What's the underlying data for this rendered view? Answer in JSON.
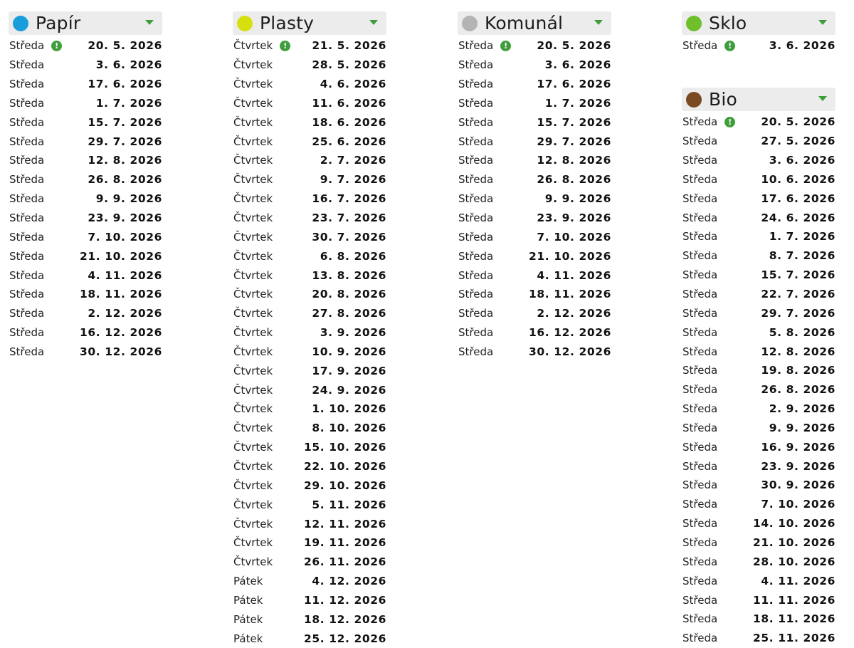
{
  "columns": [
    {
      "title": "Papír",
      "color": "#1a9ddb",
      "rows": [
        {
          "day": "Středa",
          "date": "20. 5. 2026",
          "alert": true
        },
        {
          "day": "Středa",
          "date": "3. 6. 2026"
        },
        {
          "day": "Středa",
          "date": "17. 6. 2026"
        },
        {
          "day": "Středa",
          "date": "1. 7. 2026"
        },
        {
          "day": "Středa",
          "date": "15. 7. 2026"
        },
        {
          "day": "Středa",
          "date": "29. 7. 2026"
        },
        {
          "day": "Středa",
          "date": "12. 8. 2026"
        },
        {
          "day": "Středa",
          "date": "26. 8. 2026"
        },
        {
          "day": "Středa",
          "date": "9. 9. 2026"
        },
        {
          "day": "Středa",
          "date": "23. 9. 2026"
        },
        {
          "day": "Středa",
          "date": "7. 10. 2026"
        },
        {
          "day": "Středa",
          "date": "21. 10. 2026"
        },
        {
          "day": "Středa",
          "date": "4. 11. 2026"
        },
        {
          "day": "Středa",
          "date": "18. 11. 2026"
        },
        {
          "day": "Středa",
          "date": "2. 12. 2026"
        },
        {
          "day": "Středa",
          "date": "16. 12. 2026"
        },
        {
          "day": "Středa",
          "date": "30. 12. 2026"
        }
      ]
    },
    {
      "title": "Plasty",
      "color": "#d6e00e",
      "rows": [
        {
          "day": "Čtvrtek",
          "date": "21. 5. 2026",
          "alert": true
        },
        {
          "day": "Čtvrtek",
          "date": "28. 5. 2026"
        },
        {
          "day": "Čtvrtek",
          "date": "4. 6. 2026"
        },
        {
          "day": "Čtvrtek",
          "date": "11. 6. 2026"
        },
        {
          "day": "Čtvrtek",
          "date": "18. 6. 2026"
        },
        {
          "day": "Čtvrtek",
          "date": "25. 6. 2026"
        },
        {
          "day": "Čtvrtek",
          "date": "2. 7. 2026"
        },
        {
          "day": "Čtvrtek",
          "date": "9. 7. 2026"
        },
        {
          "day": "Čtvrtek",
          "date": "16. 7. 2026"
        },
        {
          "day": "Čtvrtek",
          "date": "23. 7. 2026"
        },
        {
          "day": "Čtvrtek",
          "date": "30. 7. 2026"
        },
        {
          "day": "Čtvrtek",
          "date": "6. 8. 2026"
        },
        {
          "day": "Čtvrtek",
          "date": "13. 8. 2026"
        },
        {
          "day": "Čtvrtek",
          "date": "20. 8. 2026"
        },
        {
          "day": "Čtvrtek",
          "date": "27. 8. 2026"
        },
        {
          "day": "Čtvrtek",
          "date": "3. 9. 2026"
        },
        {
          "day": "Čtvrtek",
          "date": "10. 9. 2026"
        },
        {
          "day": "Čtvrtek",
          "date": "17. 9. 2026"
        },
        {
          "day": "Čtvrtek",
          "date": "24. 9. 2026"
        },
        {
          "day": "Čtvrtek",
          "date": "1. 10. 2026"
        },
        {
          "day": "Čtvrtek",
          "date": "8. 10. 2026"
        },
        {
          "day": "Čtvrtek",
          "date": "15. 10. 2026"
        },
        {
          "day": "Čtvrtek",
          "date": "22. 10. 2026"
        },
        {
          "day": "Čtvrtek",
          "date": "29. 10. 2026"
        },
        {
          "day": "Čtvrtek",
          "date": "5. 11. 2026"
        },
        {
          "day": "Čtvrtek",
          "date": "12. 11. 2026"
        },
        {
          "day": "Čtvrtek",
          "date": "19. 11. 2026"
        },
        {
          "day": "Čtvrtek",
          "date": "26. 11. 2026"
        },
        {
          "day": "Pátek",
          "date": "4. 12. 2026"
        },
        {
          "day": "Pátek",
          "date": "11. 12. 2026"
        },
        {
          "day": "Pátek",
          "date": "18. 12. 2026"
        },
        {
          "day": "Pátek",
          "date": "25. 12. 2026"
        }
      ]
    },
    {
      "title": "Komunál",
      "color": "#b4b4b4",
      "rows": [
        {
          "day": "Středa",
          "date": "20. 5. 2026",
          "alert": true
        },
        {
          "day": "Středa",
          "date": "3. 6. 2026"
        },
        {
          "day": "Středa",
          "date": "17. 6. 2026"
        },
        {
          "day": "Středa",
          "date": "1. 7. 2026"
        },
        {
          "day": "Středa",
          "date": "15. 7. 2026"
        },
        {
          "day": "Středa",
          "date": "29. 7. 2026"
        },
        {
          "day": "Středa",
          "date": "12. 8. 2026"
        },
        {
          "day": "Středa",
          "date": "26. 8. 2026"
        },
        {
          "day": "Středa",
          "date": "9. 9. 2026"
        },
        {
          "day": "Středa",
          "date": "23. 9. 2026"
        },
        {
          "day": "Středa",
          "date": "7. 10. 2026"
        },
        {
          "day": "Středa",
          "date": "21. 10. 2026"
        },
        {
          "day": "Středa",
          "date": "4. 11. 2026"
        },
        {
          "day": "Středa",
          "date": "18. 11. 2026"
        },
        {
          "day": "Středa",
          "date": "2. 12. 2026"
        },
        {
          "day": "Středa",
          "date": "16. 12. 2026"
        },
        {
          "day": "Středa",
          "date": "30. 12. 2026"
        }
      ]
    },
    {
      "title": "Sklo",
      "color": "#6fbf2a",
      "rows": [
        {
          "day": "Středa",
          "date": "3. 6. 2026",
          "alert": true
        }
      ]
    },
    {
      "title": "Bio",
      "color": "#7a4a21",
      "rows": [
        {
          "day": "Středa",
          "date": "20. 5. 2026",
          "alert": true
        },
        {
          "day": "Středa",
          "date": "27. 5. 2026"
        },
        {
          "day": "Středa",
          "date": "3. 6. 2026"
        },
        {
          "day": "Středa",
          "date": "10. 6. 2026"
        },
        {
          "day": "Středa",
          "date": "17. 6. 2026"
        },
        {
          "day": "Středa",
          "date": "24. 6. 2026"
        },
        {
          "day": "Středa",
          "date": "1. 7. 2026"
        },
        {
          "day": "Středa",
          "date": "8. 7. 2026"
        },
        {
          "day": "Středa",
          "date": "15. 7. 2026"
        },
        {
          "day": "Středa",
          "date": "22. 7. 2026"
        },
        {
          "day": "Středa",
          "date": "29. 7. 2026"
        },
        {
          "day": "Středa",
          "date": "5. 8. 2026"
        },
        {
          "day": "Středa",
          "date": "12. 8. 2026"
        },
        {
          "day": "Středa",
          "date": "19. 8. 2026"
        },
        {
          "day": "Středa",
          "date": "26. 8. 2026"
        },
        {
          "day": "Středa",
          "date": "2. 9. 2026"
        },
        {
          "day": "Středa",
          "date": "9. 9. 2026"
        },
        {
          "day": "Středa",
          "date": "16. 9. 2026"
        },
        {
          "day": "Středa",
          "date": "23. 9. 2026"
        },
        {
          "day": "Středa",
          "date": "30. 9. 2026"
        },
        {
          "day": "Středa",
          "date": "7. 10. 2026"
        },
        {
          "day": "Středa",
          "date": "14. 10. 2026"
        },
        {
          "day": "Středa",
          "date": "21. 10. 2026"
        },
        {
          "day": "Středa",
          "date": "28. 10. 2026"
        },
        {
          "day": "Středa",
          "date": "4. 11. 2026"
        },
        {
          "day": "Středa",
          "date": "11. 11. 2026"
        },
        {
          "day": "Středa",
          "date": "18. 11. 2026"
        },
        {
          "day": "Středa",
          "date": "25. 11. 2026"
        }
      ]
    }
  ],
  "icons": {
    "alert": "!"
  }
}
